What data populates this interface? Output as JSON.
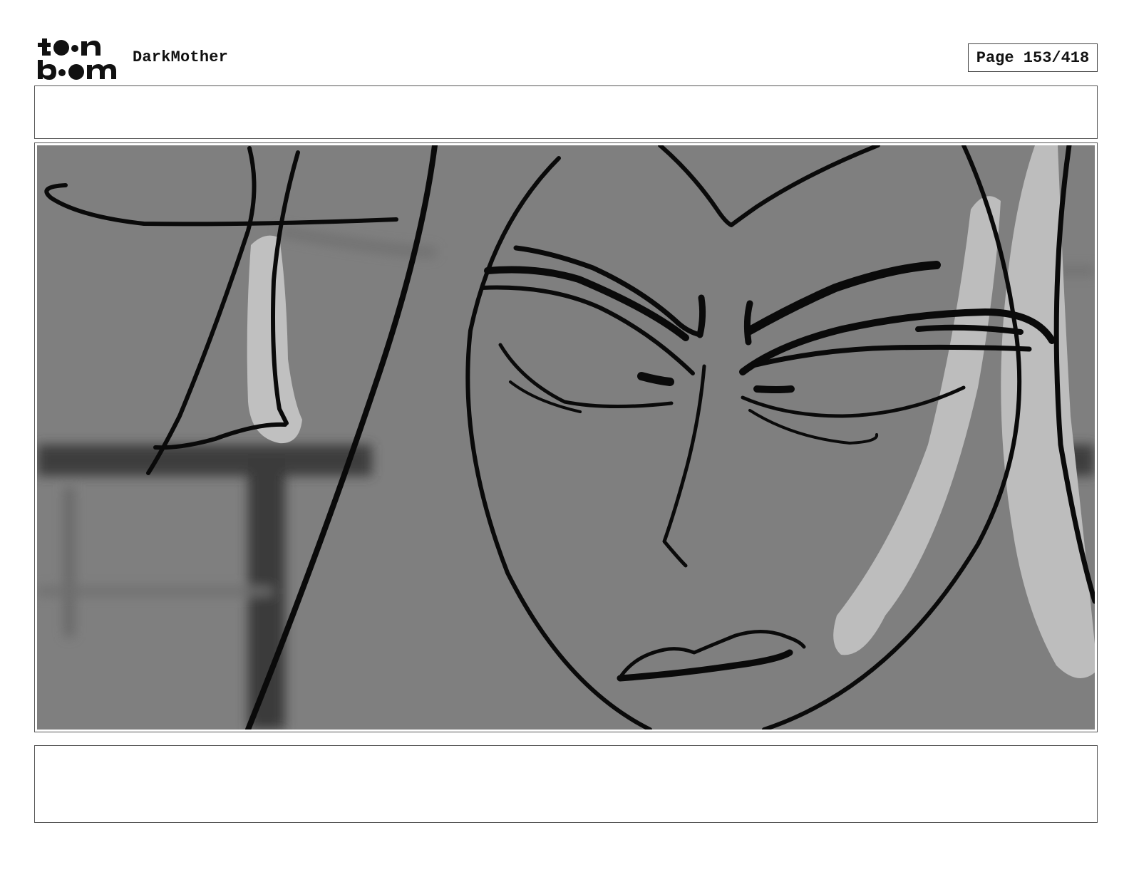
{
  "header": {
    "logo_alt": "toon boom",
    "project_name": "DarkMother",
    "page_label": "Page 153/418"
  },
  "panel": {
    "sketch_description_icon": "storyboard-sketch-face"
  }
}
